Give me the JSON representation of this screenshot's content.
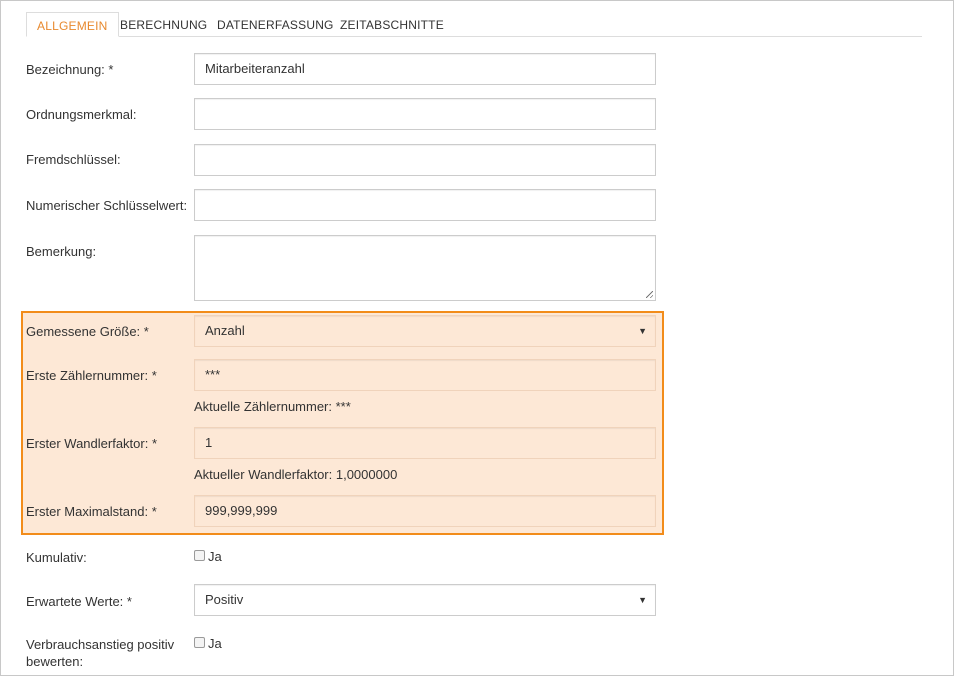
{
  "tabs": [
    {
      "label": "ALLGEMEIN"
    },
    {
      "label": "BERECHNUNG"
    },
    {
      "label": "DATENERFASSUNG"
    },
    {
      "label": "ZEITABSCHNITTE"
    }
  ],
  "colors": {
    "accent": "#e8892e",
    "highlight_border": "#f28c1a",
    "highlight_bg": "#fde8d6"
  },
  "form": {
    "bezeichnung": {
      "label": "Bezeichnung: *",
      "value": "Mitarbeiteranzahl"
    },
    "ordnungsmerkmal": {
      "label": "Ordnungsmerkmal:",
      "value": ""
    },
    "fremdschluessel": {
      "label": "Fremdschlüssel:",
      "value": ""
    },
    "numerischer": {
      "label": "Numerischer Schlüsselwert:",
      "value": ""
    },
    "bemerkung": {
      "label": "Bemerkung:",
      "value": ""
    },
    "gemessene_groesse": {
      "label": "Gemessene Größe: *",
      "value": "Anzahl"
    },
    "erste_zaehlernummer": {
      "label": "Erste Zählernummer: *",
      "value": "***",
      "help": "Aktuelle Zählernummer: ***"
    },
    "erster_wandlerfaktor": {
      "label": "Erster Wandlerfaktor: *",
      "value": "1",
      "help": "Aktueller Wandlerfaktor: 1,0000000"
    },
    "erster_maximalstand": {
      "label": "Erster Maximalstand: *",
      "value": "999,999,999"
    },
    "kumulativ": {
      "label": "Kumulativ:",
      "checkbox_label": "Ja",
      "checked": false
    },
    "erwartete_werte": {
      "label": "Erwartete Werte: *",
      "value": "Positiv"
    },
    "verbrauchsanstieg": {
      "label": "Verbrauchsanstieg positiv bewerten:",
      "checkbox_label": "Ja",
      "checked": false
    }
  }
}
